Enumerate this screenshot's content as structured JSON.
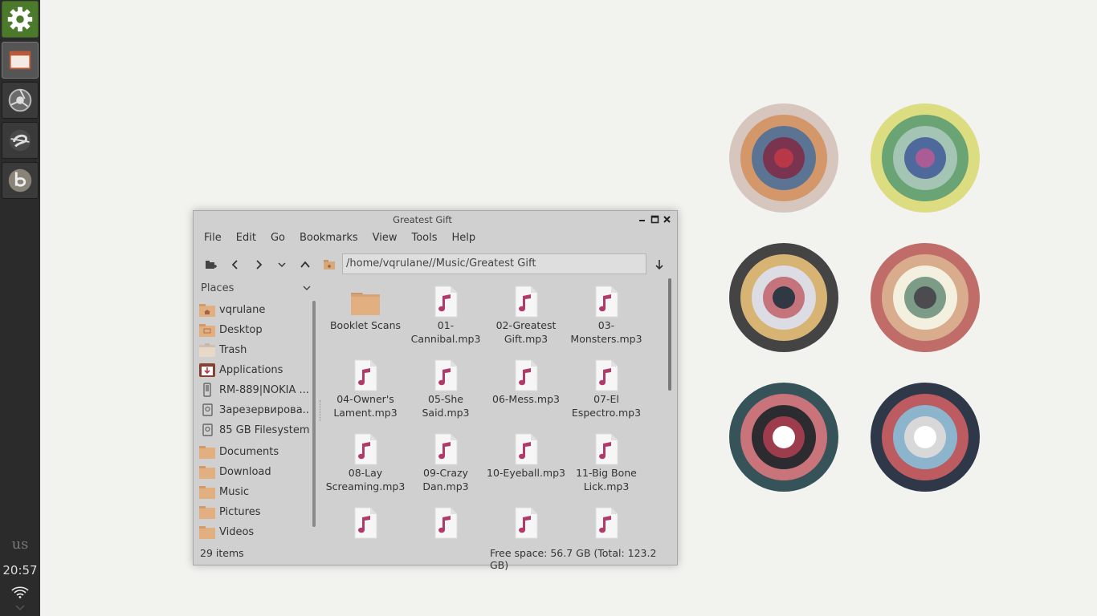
{
  "panel": {
    "launchers": [
      {
        "name": "settings",
        "icon": "gear-icon"
      },
      {
        "name": "files",
        "icon": "folder-window-icon"
      },
      {
        "name": "browser",
        "icon": "browser-icon"
      },
      {
        "name": "media",
        "icon": "media-icon"
      },
      {
        "name": "app",
        "icon": "b-app-icon"
      }
    ],
    "keyboard_layout": "us",
    "clock": "20:57",
    "wifi_icon": "wifi-icon"
  },
  "window": {
    "title": "Greatest Gift",
    "menu": [
      "File",
      "Edit",
      "Go",
      "Bookmarks",
      "View",
      "Tools",
      "Help"
    ],
    "location": "/home/vqrulane//Music/Greatest Gift",
    "sidebar": {
      "header": "Places",
      "items": [
        {
          "label": "vqrulane",
          "icon": "home-folder-icon"
        },
        {
          "label": "Desktop",
          "icon": "desktop-folder-icon"
        },
        {
          "label": "Trash",
          "icon": "trash-icon"
        },
        {
          "label": "Applications",
          "icon": "applications-icon"
        },
        {
          "label": "RM-889|NOKIA ...",
          "icon": "phone-icon"
        },
        {
          "label": "Зарезервирова...",
          "icon": "drive-icon"
        },
        {
          "label": "85 GB Filesystem",
          "icon": "drive-icon"
        },
        {
          "label": "Documents",
          "icon": "folder-icon"
        },
        {
          "label": "Download",
          "icon": "folder-icon"
        },
        {
          "label": "Music",
          "icon": "folder-icon"
        },
        {
          "label": "Pictures",
          "icon": "folder-icon"
        },
        {
          "label": "Videos",
          "icon": "folder-icon"
        }
      ]
    },
    "files": [
      {
        "name": "Booklet Scans",
        "type": "folder"
      },
      {
        "name": "01-\nCannibal.mp3",
        "type": "audio"
      },
      {
        "name": "02-Greatest\nGift.mp3",
        "type": "audio"
      },
      {
        "name": "03-\nMonsters.mp3",
        "type": "audio"
      },
      {
        "name": "04-Owner's\nLament.mp3",
        "type": "audio"
      },
      {
        "name": "05-She\nSaid.mp3",
        "type": "audio"
      },
      {
        "name": "06-Mess.mp3",
        "type": "audio"
      },
      {
        "name": "07-El\nEspectro.mp3",
        "type": "audio"
      },
      {
        "name": "08-Lay\nScreaming.mp3",
        "type": "audio"
      },
      {
        "name": "09-Crazy\nDan.mp3",
        "type": "audio"
      },
      {
        "name": "10-Eyeball.mp3",
        "type": "audio"
      },
      {
        "name": "11-Big Bone\nLick.mp3",
        "type": "audio"
      },
      {
        "name": "",
        "type": "audio"
      },
      {
        "name": "",
        "type": "audio"
      },
      {
        "name": "",
        "type": "audio"
      },
      {
        "name": "",
        "type": "audio"
      }
    ],
    "status": {
      "items": "29 items",
      "free_space": "Free space: 56.7 GB (Total: 123.2 GB)"
    }
  },
  "colors": {
    "panel_bg": "#2b2b2b",
    "desktop_bg": "#f2f2ef",
    "window_bg": "#d0d0d0",
    "folder": "#e2b080",
    "audio_accent": "#b03a6a"
  }
}
